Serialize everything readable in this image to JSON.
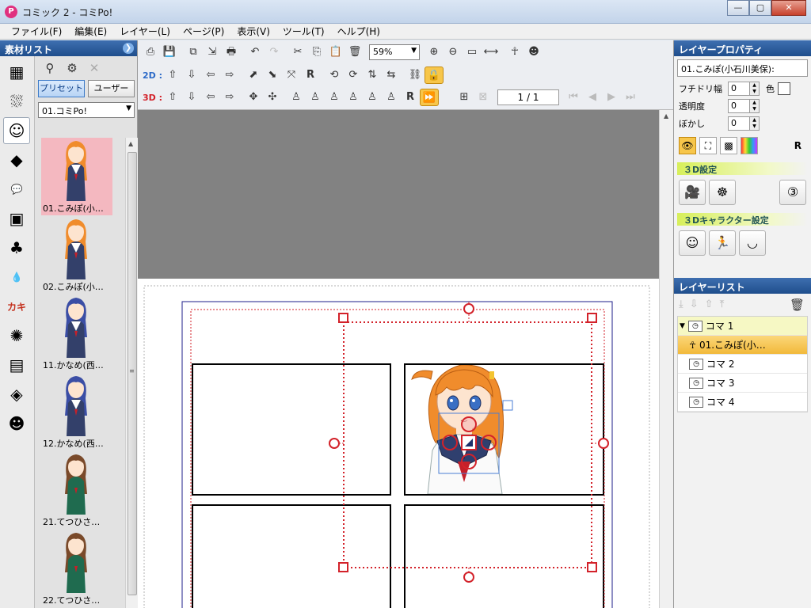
{
  "window": {
    "title": "コミック 2 - コミPo!",
    "app_icon": "comipo-app-icon",
    "buttons": [
      "—",
      "▢",
      "✕"
    ]
  },
  "menu": [
    "ファイル(F)",
    "編集(E)",
    "レイヤー(L)",
    "ページ(P)",
    "表示(V)",
    "ツール(T)",
    "ヘルプ(H)"
  ],
  "left_panel": {
    "title": "素材リスト",
    "collapse_glyph": "❯",
    "categories": [
      {
        "name": "panel-layout-icon",
        "glyph": "▦"
      },
      {
        "name": "background-icon",
        "glyph": "⛆"
      },
      {
        "name": "character-icon",
        "glyph": "☺",
        "active": true
      },
      {
        "name": "3d-object-icon",
        "glyph": "◆"
      },
      {
        "name": "speech-bubble-icon",
        "glyph": "💬"
      },
      {
        "name": "image-icon",
        "glyph": "▣"
      },
      {
        "name": "tree-icon",
        "glyph": "♣"
      },
      {
        "name": "drop-icon",
        "glyph": "💧"
      },
      {
        "name": "text-icon",
        "glyph": "カキ"
      },
      {
        "name": "effect-icon",
        "glyph": "✺"
      },
      {
        "name": "user-image-icon",
        "glyph": "▤"
      },
      {
        "name": "user-3d-icon",
        "glyph": "◈"
      },
      {
        "name": "user-character-icon",
        "glyph": "☻"
      }
    ],
    "filters": {
      "preset": "プリセット",
      "user": "ユーザー"
    },
    "selected_set": "01.コミPo!",
    "thumbnails": [
      {
        "label": "01.こみぽ(小…",
        "hair": "#f08c2c",
        "skin": "#fde4cf",
        "outfit": "#33406a",
        "collar": "#ffffff",
        "selected": true
      },
      {
        "label": "02.こみぽ(小…",
        "hair": "#f08c2c",
        "skin": "#fde4cf",
        "outfit": "#33406a",
        "collar": "#ffffff"
      },
      {
        "label": "11.かなめ(西…",
        "hair": "#3b4ea5",
        "skin": "#fde4cf",
        "outfit": "#33406a",
        "collar": "#ffffff"
      },
      {
        "label": "12.かなめ(西…",
        "hair": "#3b4ea5",
        "skin": "#fde4cf",
        "outfit": "#33406a",
        "collar": "#ffffff"
      },
      {
        "label": "21.てつひさ…",
        "hair": "#7a4a2a",
        "skin": "#fde4cf",
        "outfit": "#1f6b4f",
        "collar": "#1f6b4f"
      },
      {
        "label": "22.てつひさ…",
        "hair": "#7a4a2a",
        "skin": "#fde4cf",
        "outfit": "#1f6b4f",
        "collar": "#1f6b4f"
      }
    ]
  },
  "toolbar": {
    "zoom": "59%",
    "labels": {
      "2d": "2D :",
      "3d": "3D :"
    },
    "page": "1 / 1",
    "r": "R"
  },
  "right_panel": {
    "title": "レイヤープロパティ",
    "layer_name": "01.こみぽ(小石川美保):",
    "props": [
      {
        "label": "フチドリ幅",
        "value": "0",
        "extra": "色"
      },
      {
        "label": "透明度",
        "value": "0"
      },
      {
        "label": "ぼかし",
        "value": "0"
      }
    ],
    "r": "R",
    "section_3d": "３D設定",
    "section_3d_char": "３Dキャラクター設定",
    "layer_list_title": "レイヤーリスト",
    "layers": [
      {
        "label": "コマ 1",
        "type": "group",
        "expanded": true
      },
      {
        "label": "01.こみぽ(小…",
        "type": "sub"
      },
      {
        "label": "コマ 2",
        "type": "frame"
      },
      {
        "label": "コマ 3",
        "type": "frame"
      },
      {
        "label": "コマ 4",
        "type": "frame"
      }
    ]
  },
  "colors": {
    "selection": "#d3222a",
    "panel_border": "#000000",
    "page_border": "#1c1c8a"
  }
}
